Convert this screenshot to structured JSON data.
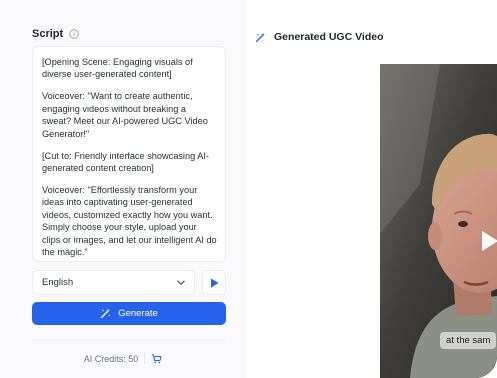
{
  "script_panel": {
    "label": "Script",
    "paragraphs": [
      "[Opening Scene: Engaging visuals of diverse user-generated content]",
      "Voiceover: \"Want to create authentic, engaging videos without breaking a sweat? Meet our AI-powered UGC Video Generator!\"",
      "[Cut to: Friendly interface showcasing AI-generated content creation]",
      "Voiceover: \"Effortlessly transform your ideas into captivating user-generated videos, customized exactly how you want. Simply choose your style, upload your clips or images, and let our intelligent AI do the magic.\""
    ],
    "language": "English",
    "generate_label": "Generate",
    "credits_text": "AI Credits: 50"
  },
  "video_panel": {
    "title": "Generated UGC Video",
    "caption": "at the sam"
  },
  "colors": {
    "accent": "#2563eb",
    "text_dark": "#1f2733",
    "muted": "#6b7280"
  },
  "icons": {
    "info": "info-icon",
    "chevron": "chevron-down-icon",
    "play": "play-icon",
    "wand": "magic-wand-icon",
    "cart": "cart-icon"
  }
}
